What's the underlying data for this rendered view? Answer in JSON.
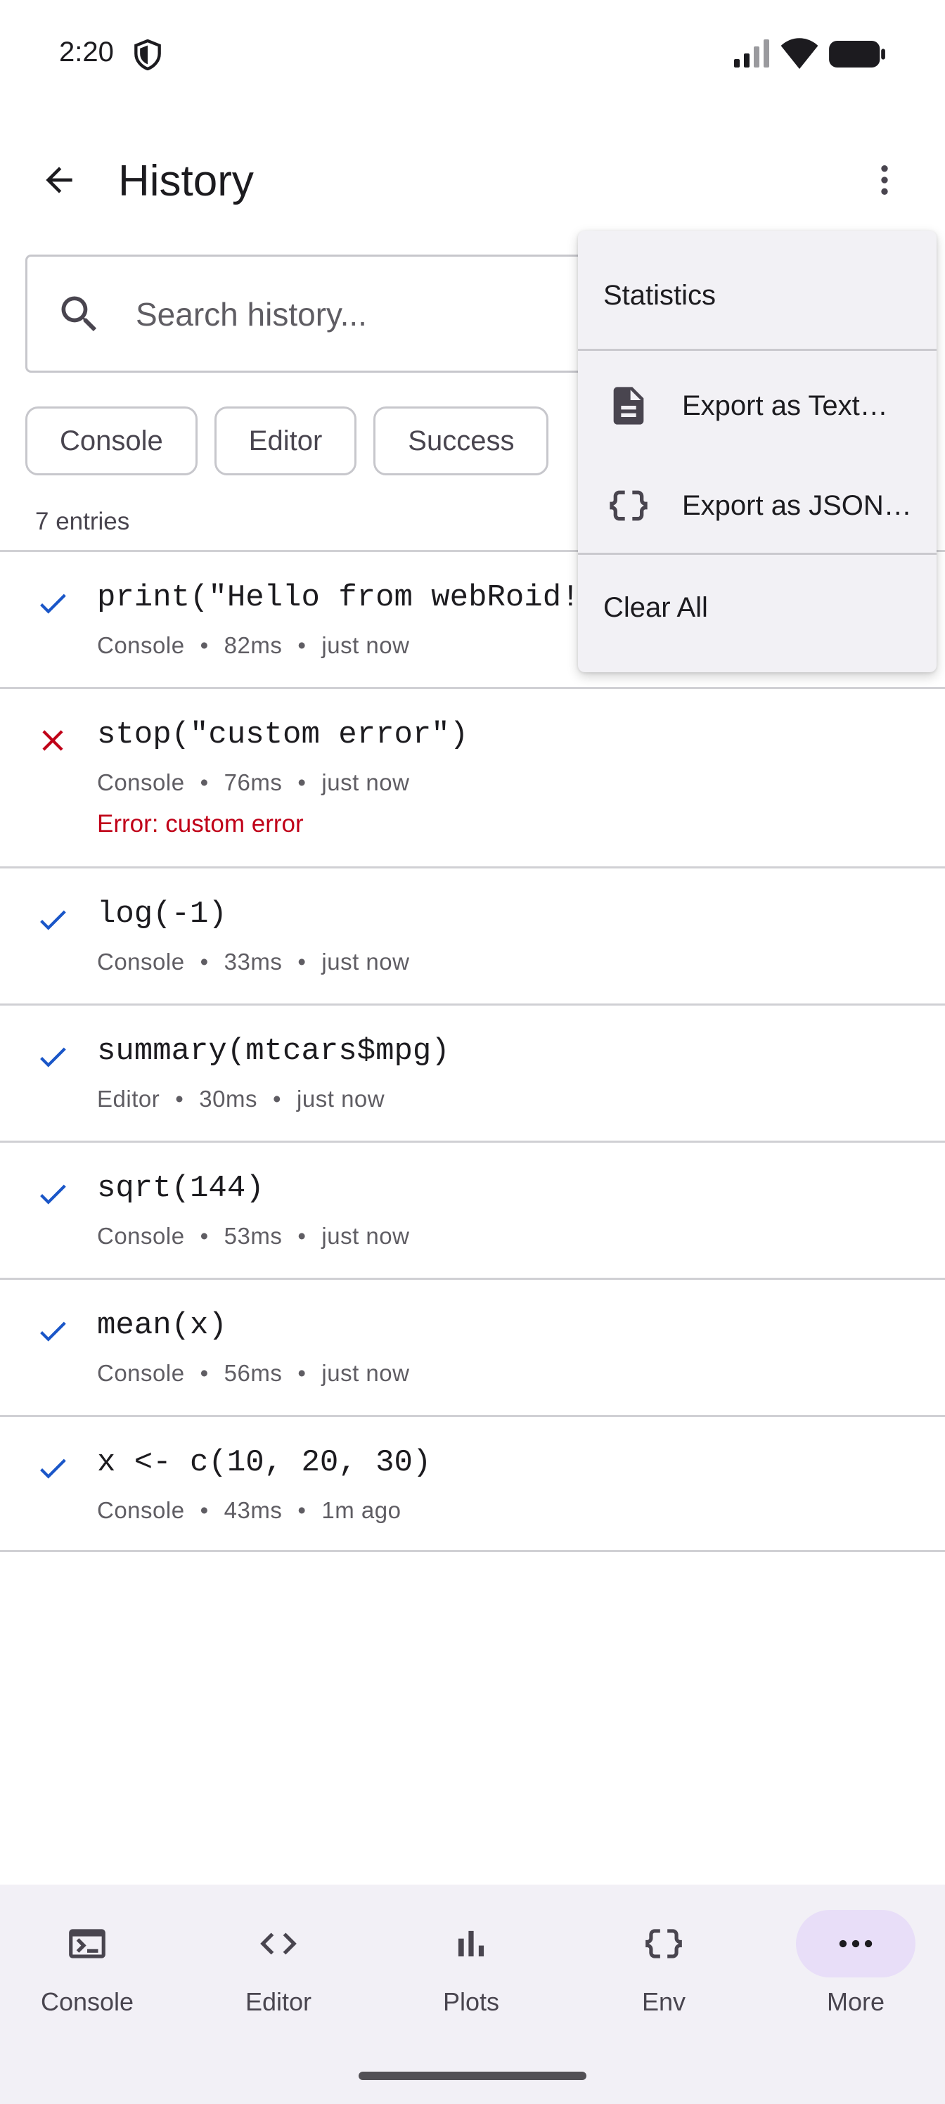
{
  "status_bar": {
    "time": "2:20"
  },
  "app_bar": {
    "title": "History"
  },
  "search": {
    "placeholder": "Search history..."
  },
  "filters": {
    "chips": [
      "Console",
      "Editor",
      "Success"
    ]
  },
  "entry_count": "7 entries",
  "history": [
    {
      "status": "success",
      "code": "print(\"Hello from webRoid!\")",
      "source": "Console",
      "duration": "82ms",
      "time": "just now",
      "error": ""
    },
    {
      "status": "error",
      "code": "stop(\"custom error\")",
      "source": "Console",
      "duration": "76ms",
      "time": "just now",
      "error": "Error: custom error"
    },
    {
      "status": "success",
      "code": "log(-1)",
      "source": "Console",
      "duration": "33ms",
      "time": "just now",
      "error": ""
    },
    {
      "status": "success",
      "code": "summary(mtcars$mpg)",
      "source": "Editor",
      "duration": "30ms",
      "time": "just now",
      "error": ""
    },
    {
      "status": "success",
      "code": "sqrt(144)",
      "source": "Console",
      "duration": "53ms",
      "time": "just now",
      "error": ""
    },
    {
      "status": "success",
      "code": "mean(x)",
      "source": "Console",
      "duration": "56ms",
      "time": "just now",
      "error": ""
    },
    {
      "status": "success",
      "code": "x <- c(10, 20, 30)",
      "source": "Console",
      "duration": "43ms",
      "time": "1m ago",
      "error": ""
    }
  ],
  "menu": {
    "statistics": "Statistics",
    "export_text": "Export as Text…",
    "export_json": "Export as JSON…",
    "clear_all": "Clear All"
  },
  "bottom_nav": {
    "items": [
      {
        "label": "Console",
        "icon": "terminal-icon"
      },
      {
        "label": "Editor",
        "icon": "code-icon"
      },
      {
        "label": "Plots",
        "icon": "bar-chart-icon"
      },
      {
        "label": "Env",
        "icon": "braces-icon"
      },
      {
        "label": "More",
        "icon": "more-horiz-icon"
      }
    ],
    "active": "More"
  },
  "colors": {
    "success": "#1a56c8",
    "error": "#c00018",
    "nav_active": "#e8def8",
    "menu_bg": "#f2f1f5",
    "nav_bg": "#f2f0f6"
  }
}
